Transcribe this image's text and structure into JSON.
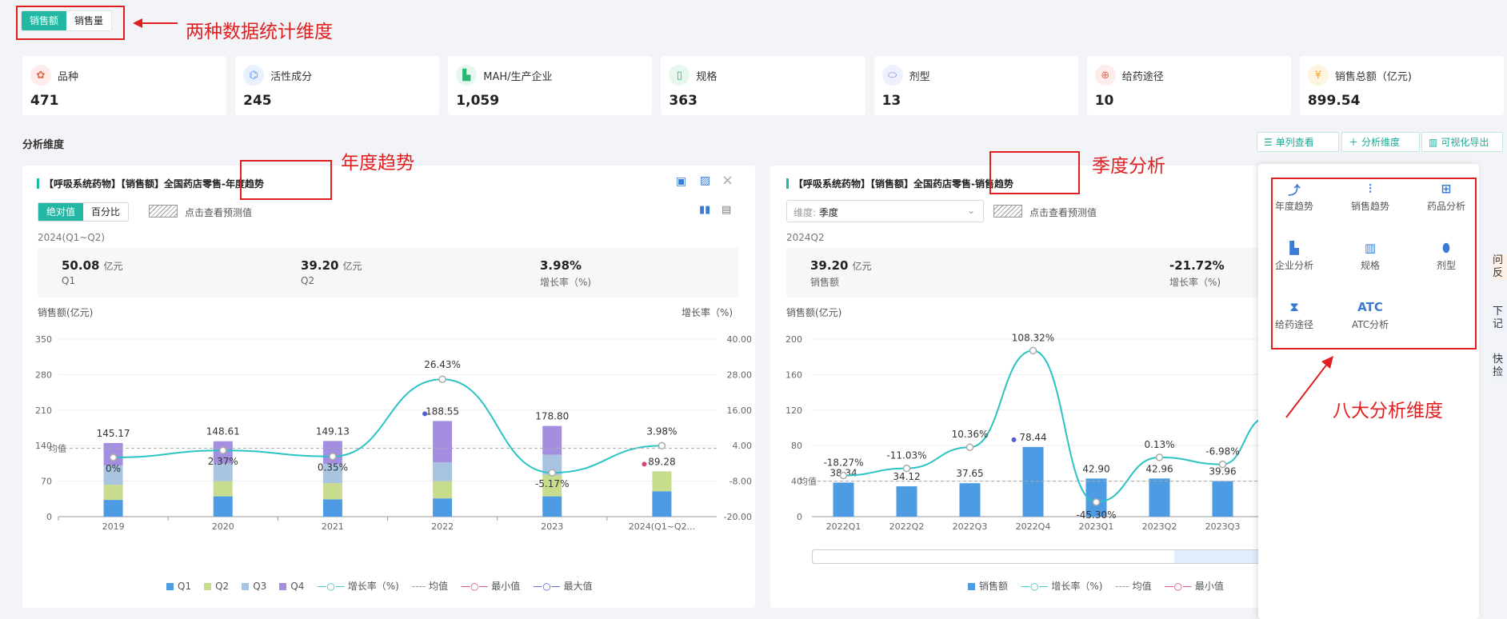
{
  "toggle": {
    "a": "销售额",
    "b": "销售量"
  },
  "ann": {
    "dims": "两种数据统计维度",
    "year": "年度趋势",
    "quarter": "季度分析",
    "eight": "八大分析维度"
  },
  "cards": [
    {
      "label": "品种",
      "value": "471",
      "icon": "variety-icon",
      "color": "#e8684a",
      "bg": "#fdecea"
    },
    {
      "label": "活性成分",
      "value": "245",
      "icon": "molecule-icon",
      "color": "#5b8ff9",
      "bg": "#eaf1fe"
    },
    {
      "label": "MAH/生产企业",
      "value": "1,059",
      "icon": "factory-icon",
      "color": "#2bb673",
      "bg": "#e6f7ee"
    },
    {
      "label": "规格",
      "value": "363",
      "icon": "spec-icon",
      "color": "#2bb673",
      "bg": "#e6f7ee"
    },
    {
      "label": "剂型",
      "value": "13",
      "icon": "dosage-icon",
      "color": "#6c7bd8",
      "bg": "#eef0fb"
    },
    {
      "label": "给药途径",
      "value": "10",
      "icon": "route-icon",
      "color": "#e8684a",
      "bg": "#fdecea"
    },
    {
      "label": "销售总额（亿元)",
      "value": "899.54",
      "icon": "sales-icon",
      "color": "#f5a623",
      "bg": "#fff4e0"
    }
  ],
  "section": {
    "title": "分析维度",
    "btn1": "单列查看",
    "btn2": "分析维度",
    "btn3": "可视化导出"
  },
  "left": {
    "title": "【呼吸系统药物】【销售额】全国药店零售-年度趋势",
    "seg1": "绝对值",
    "seg2": "百分比",
    "predict": "点击查看预测值",
    "period": "2024(Q1~Q2)",
    "stats": [
      {
        "n": "50.08",
        "u": "亿元",
        "l": "Q1"
      },
      {
        "n": "39.20",
        "u": "亿元",
        "l": "Q2"
      },
      {
        "n": "3.98%",
        "u": "",
        "l": "增长率（%)"
      }
    ],
    "ylabel": "销售额(亿元)",
    "y2label": "增长率（%)",
    "avg": "均值",
    "legend": [
      "Q1",
      "Q2",
      "Q3",
      "Q4",
      "增长率（%)",
      "均值",
      "最小值",
      "最大值"
    ]
  },
  "right": {
    "title": "【呼吸系统药物】【销售额】全国药店零售-销售趋势",
    "dimlabel": "维度:",
    "dimvalue": "季度",
    "predict": "点击查看预测值",
    "period": "2024Q2",
    "stats": [
      {
        "n": "39.20",
        "u": "亿元",
        "l": "销售额"
      },
      {
        "n": "-21.72%",
        "u": "",
        "l": "增长率（%)"
      }
    ],
    "ylabel": "销售额(亿元)",
    "avg": "均值",
    "legend": [
      "销售额",
      "增长率（%)",
      "均值",
      "最小值"
    ]
  },
  "menu": [
    "年度趋势",
    "销售趋势",
    "药品分析",
    "企业分析",
    "规格",
    "剂型",
    "给药途径",
    "ATC分析"
  ],
  "menu_icon_atc": "ATC",
  "edge": [
    "问反",
    "下记",
    "快捡"
  ],
  "chart_data": [
    {
      "type": "bar",
      "title": "【呼吸系统药物】【销售额】全国药店零售-年度趋势",
      "categories": [
        "2019",
        "2020",
        "2021",
        "2022",
        "2023",
        "2024(Q1~Q2..."
      ],
      "series": [
        {
          "name": "Q1",
          "values": [
            33,
            40,
            34,
            36,
            40,
            50.08
          ]
        },
        {
          "name": "Q2",
          "values": [
            30,
            30,
            32,
            34,
            42,
            39.2
          ]
        },
        {
          "name": "Q3",
          "values": [
            38,
            35,
            38,
            37,
            40,
            0
          ]
        },
        {
          "name": "Q4",
          "values": [
            44.17,
            43.61,
            45.13,
            81.55,
            56.8,
            0
          ]
        }
      ],
      "totals": [
        "145.17",
        "148.61",
        "149.13",
        "188.55",
        "178.80",
        "89.28"
      ],
      "growth": {
        "name": "增长率（%)",
        "values": [
          0,
          2.37,
          0.35,
          26.43,
          -5.17,
          3.98
        ],
        "labels": [
          "0%",
          "2.37%",
          "0.35%",
          "26.43%",
          "-5.17%",
          "3.98%"
        ]
      },
      "ylim": [
        0,
        350
      ],
      "yticks": [
        "0",
        "70",
        "140",
        "210",
        "280",
        "350"
      ],
      "y2lim": [
        -20,
        40
      ],
      "y2ticks": [
        "-20.00",
        "-8.00",
        "4.00",
        "16.00",
        "28.00",
        "40.00"
      ],
      "avg": 135
    },
    {
      "type": "bar",
      "title": "【呼吸系统药物】【销售额】全国药店零售-销售趋势",
      "categories": [
        "2022Q1",
        "2022Q2",
        "2022Q3",
        "2022Q4",
        "2023Q1",
        "2023Q2",
        "2023Q3"
      ],
      "values": [
        38.34,
        34.12,
        37.65,
        78.44,
        42.9,
        42.96,
        39.96
      ],
      "labels": [
        "38.34",
        "34.12",
        "37.65",
        "78.44",
        "42.90",
        "42.96",
        "39.96"
      ],
      "growth": {
        "values": [
          -18.27,
          -11.03,
          10.36,
          108.32,
          -45.3,
          0.13,
          -6.98
        ],
        "labels": [
          "-18.27%",
          "-11.03%",
          "10.36%",
          "108.32%",
          "-45.30%",
          "0.13%",
          "-6.98%"
        ]
      },
      "ylim": [
        0,
        200
      ],
      "yticks": [
        "0",
        "40",
        "80",
        "120",
        "160",
        "200"
      ],
      "avg": 40
    }
  ]
}
